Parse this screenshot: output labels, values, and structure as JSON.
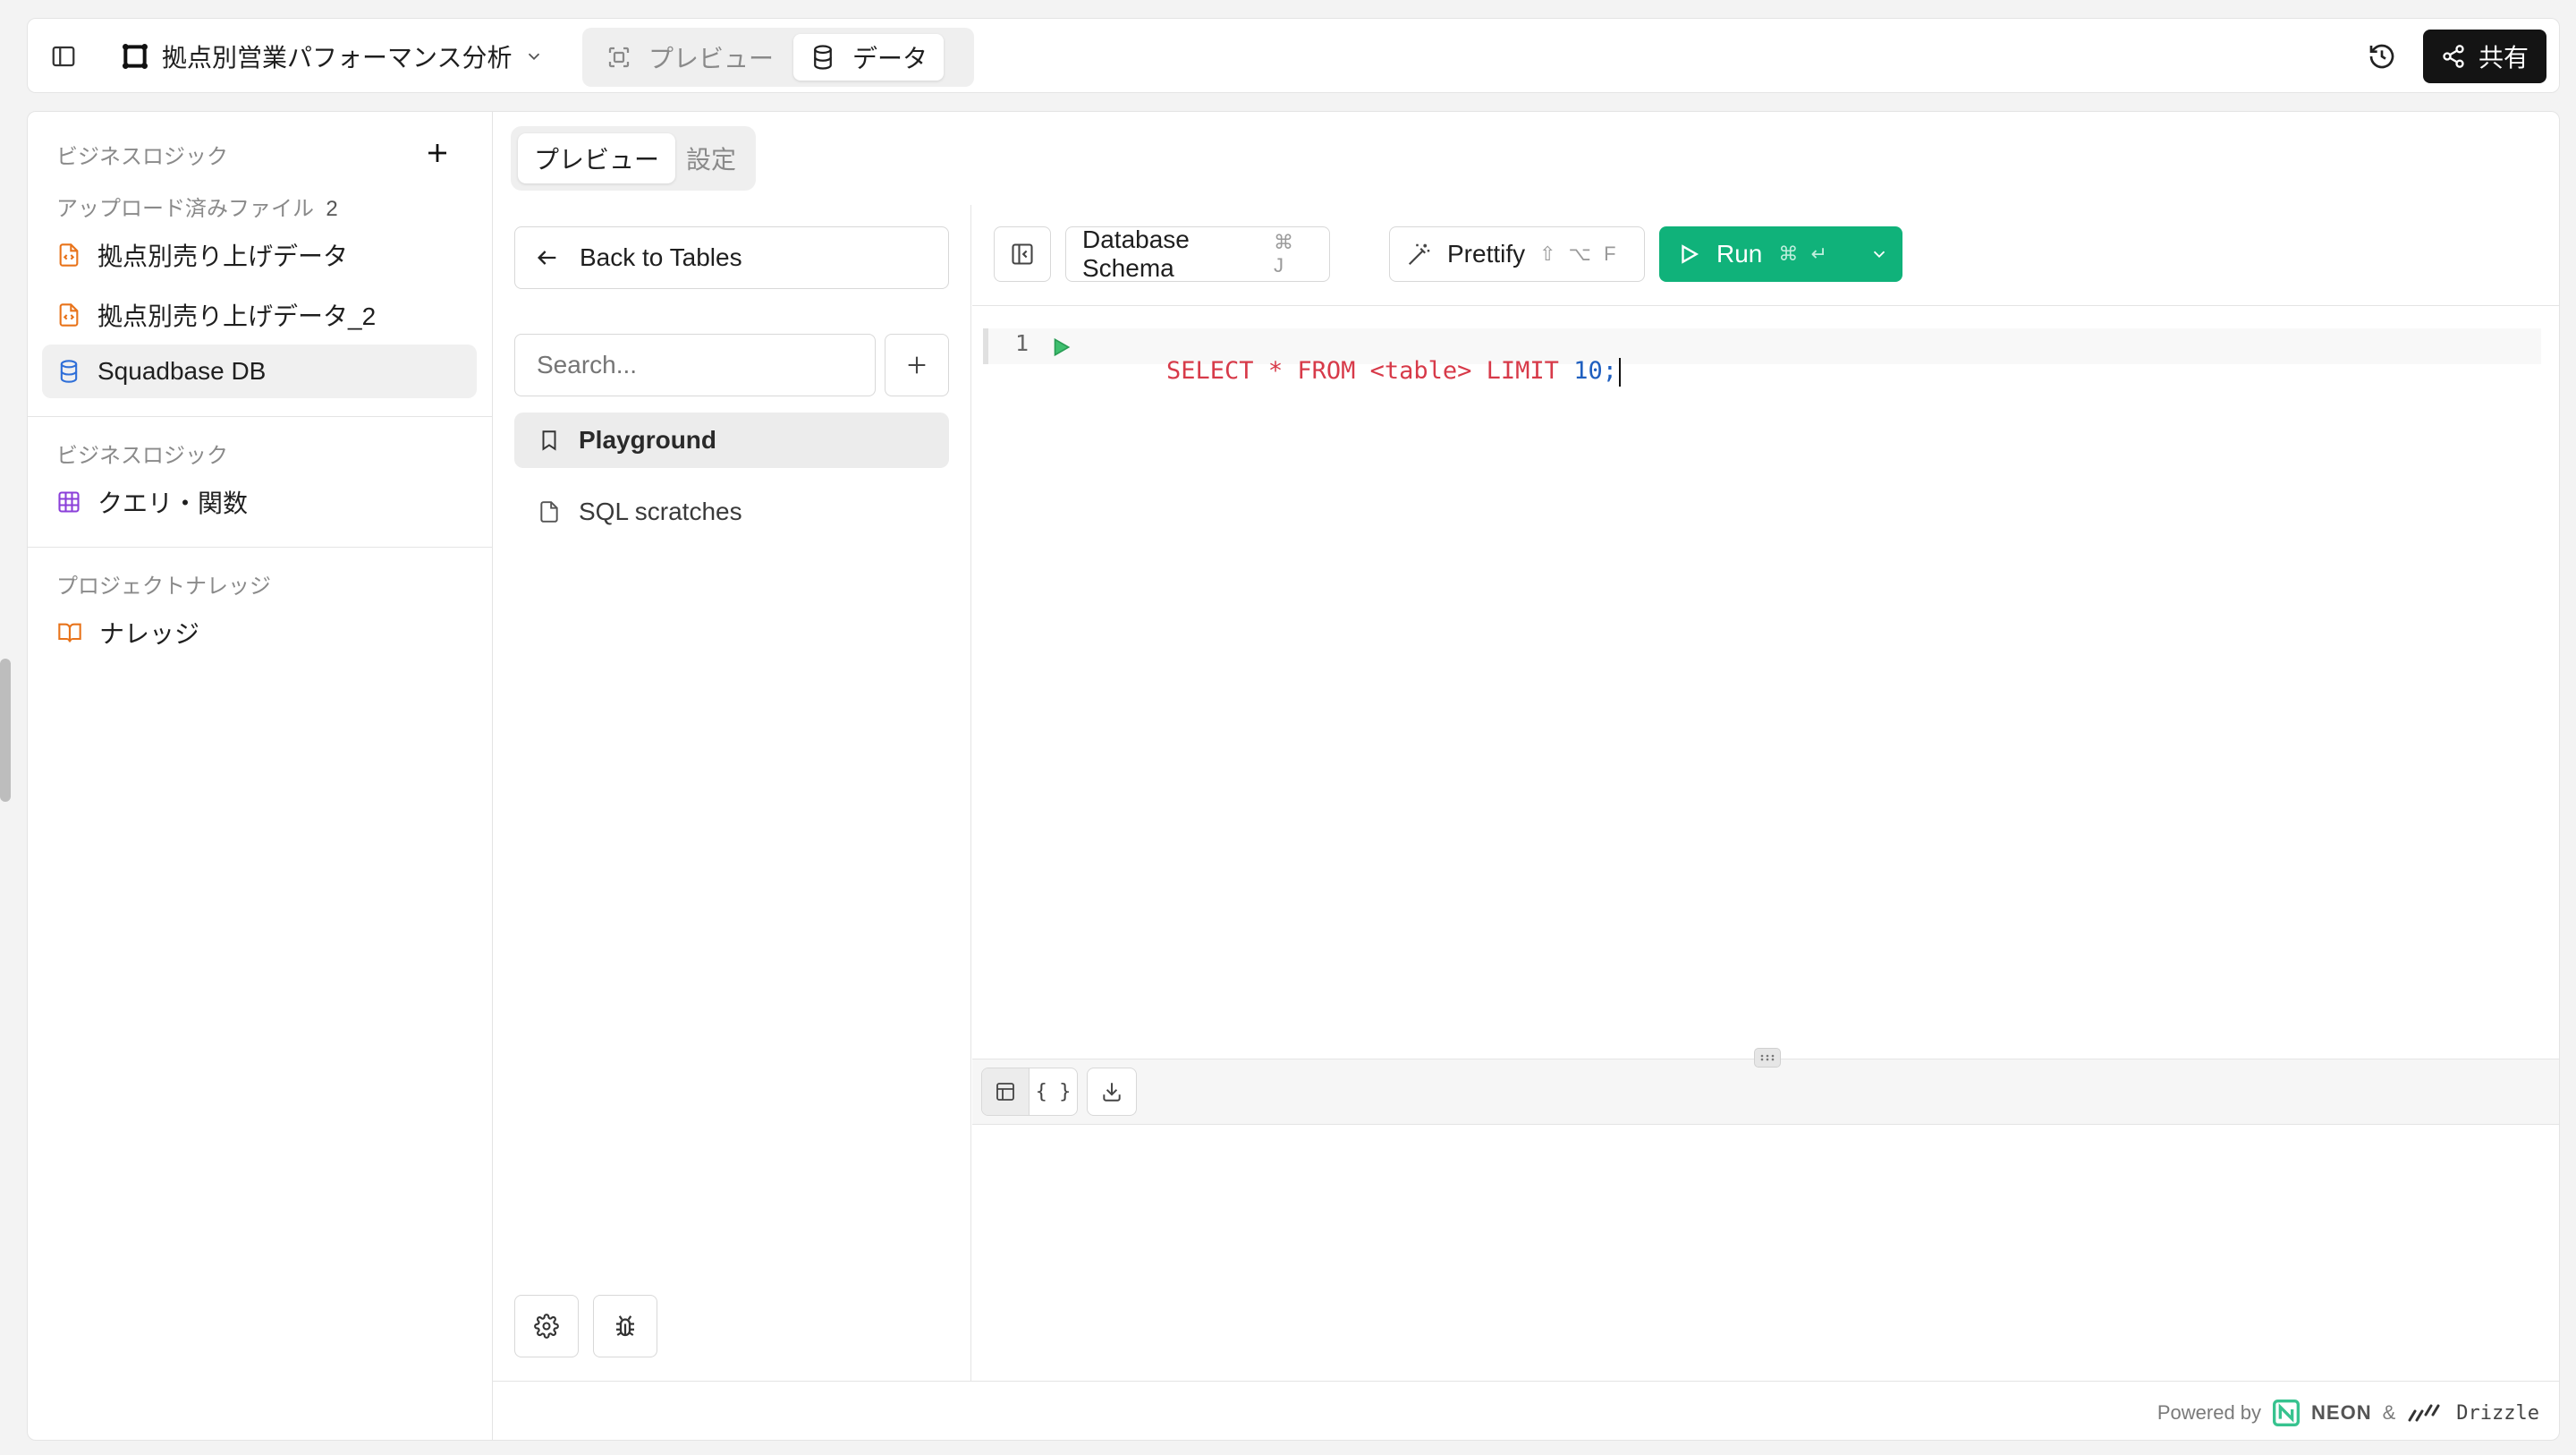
{
  "header": {
    "project_name": "拠点別営業パフォーマンス分析",
    "view_tabs": [
      {
        "label": "プレビュー",
        "active": false
      },
      {
        "label": "データ",
        "active": true
      }
    ],
    "share_label": "共有"
  },
  "sidebar": {
    "section1_label": "ビジネスロジック",
    "uploaded_label": "アップロード済みファイル",
    "uploaded_count": "2",
    "files": [
      {
        "label": "拠点別売り上げデータ"
      },
      {
        "label": "拠点別売り上げデータ_2"
      },
      {
        "label": "Squadbase DB"
      }
    ],
    "section2_label": "ビジネスロジック",
    "queries_label": "クエリ・関数",
    "section3_label": "プロジェクトナレッジ",
    "knowledge_label": "ナレッジ"
  },
  "data_panel": {
    "subtabs": [
      {
        "label": "プレビュー",
        "active": true
      },
      {
        "label": "設定",
        "active": false
      }
    ],
    "back_label": "Back to Tables",
    "search_placeholder": "Search...",
    "nav_items": [
      {
        "label": "Playground",
        "active": true
      },
      {
        "label": "SQL scratches",
        "active": false
      }
    ]
  },
  "editor": {
    "schema_label": "Database Schema",
    "schema_shortcut": "⌘ J",
    "prettify_label": "Prettify",
    "prettify_shortcut": "⇧ ⌥ F",
    "run_label": "Run",
    "run_shortcut": "⌘ ↵",
    "line_number": "1",
    "code_tokens": [
      {
        "text": "SELECT * FROM <table> LIMIT ",
        "color": "#d73a49"
      },
      {
        "text": "10",
        "color": "#1f5fbf"
      },
      {
        "text": ";",
        "color": "#1f5fbf"
      }
    ]
  },
  "footer": {
    "powered_by": "Powered by",
    "neon": "NEON",
    "amp": "&",
    "drizzle": "Drizzle"
  },
  "colors": {
    "run_green": "#10b27a",
    "file_orange": "#e8731a",
    "db_blue": "#2f6fd8",
    "query_purple": "#8b3fd9"
  }
}
